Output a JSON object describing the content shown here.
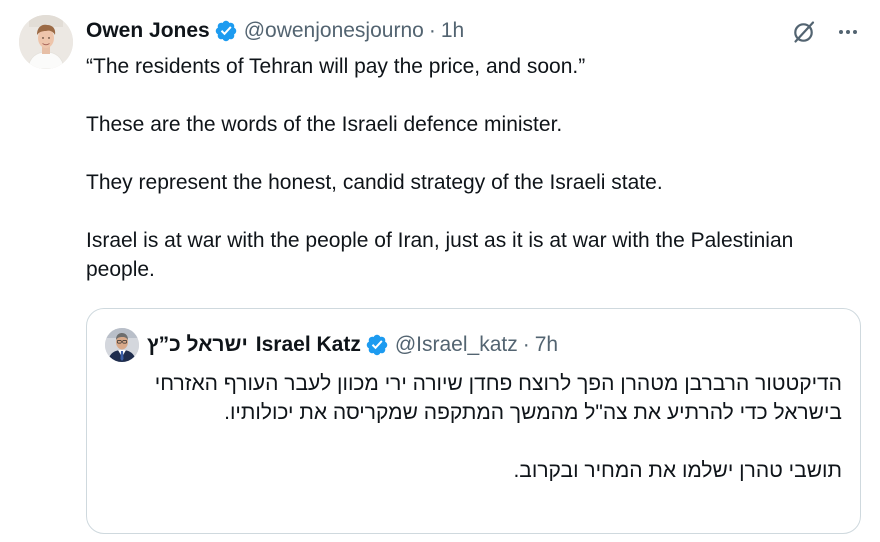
{
  "tweet": {
    "author": {
      "name": "Owen Jones",
      "handle": "@owenjonesjourno",
      "time": "1h",
      "avatar_icon": "profile-photo"
    },
    "separator": "·",
    "paragraphs": [
      "“The residents of Tehran will pay the price, and soon.”",
      "These are the words of the Israeli defence minister.",
      "They represent the honest, candid strategy of the Israeli state.",
      "Israel is at war with the people of Iran, just as it is at war with the Palestinian people."
    ],
    "actions": {
      "grok_icon": "grok-icon",
      "more_icon": "more-icon"
    }
  },
  "quote": {
    "author": {
      "name_hebrew": "ישראל כ”ץ",
      "name_english": "Israel Katz",
      "handle": "@Israel_katz",
      "time": "7h",
      "avatar_icon": "profile-photo"
    },
    "separator": "·",
    "paragraphs": [
      "הדיקטטור הרברבן מטהרן הפך לרוצח פחדן שיורה ירי מכוון לעבר העורף האזרחי בישראל כדי להרתיע את צה\"ל מהמשך המתקפה שמקריסה את יכולותיו.",
      "תושבי טהרן ישלמו את המחיר ובקרוב."
    ]
  },
  "colors": {
    "text": "#0f1419",
    "muted": "#536471",
    "verified": "#1d9bf0",
    "border": "#cfd9de"
  }
}
